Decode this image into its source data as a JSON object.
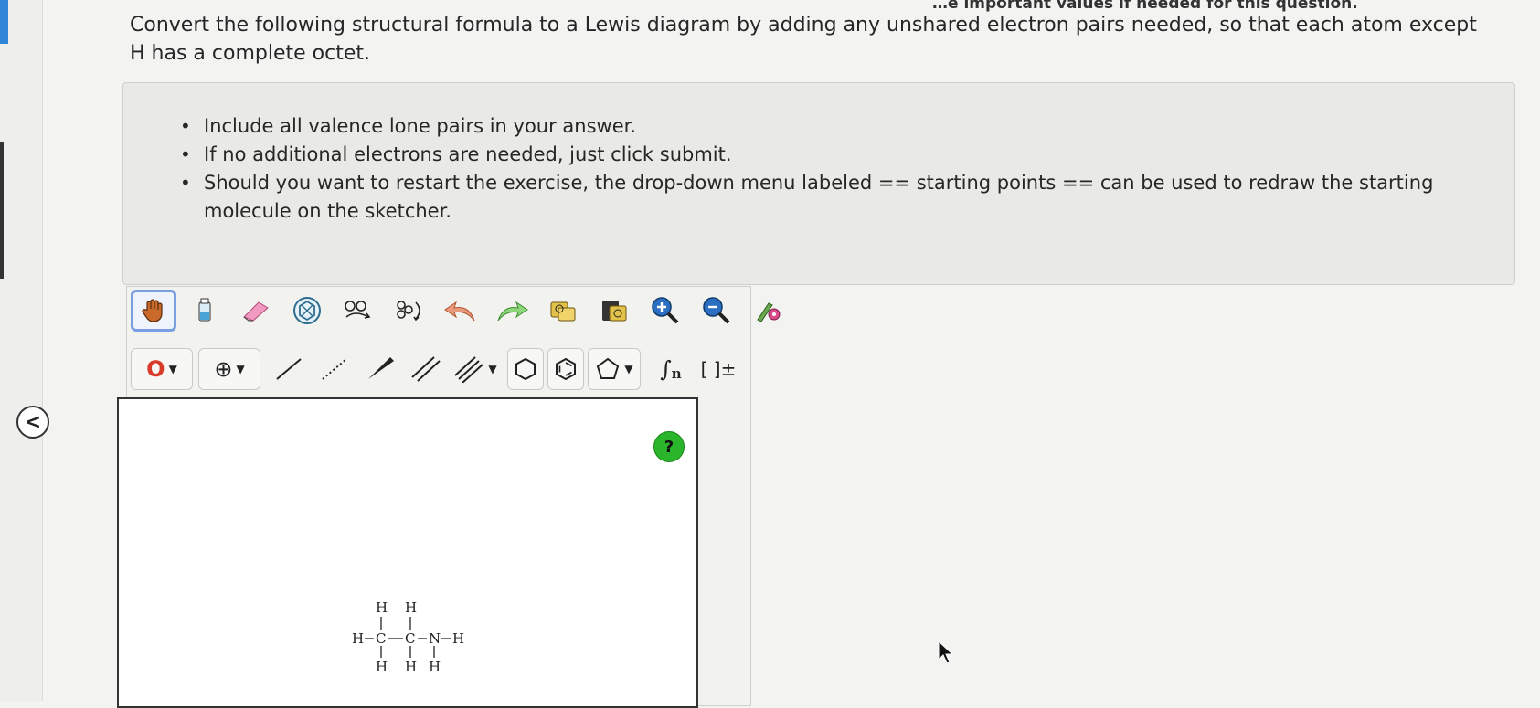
{
  "header_fragment": "…e important values if needed for this question.",
  "question": "Convert the following structural formula to a Lewis diagram by adding any unshared electron pairs needed, so that each atom except H has a complete octet.",
  "instructions": [
    "Include all valence lone pairs in your answer.",
    "If no additional electrons are needed, just click submit.",
    "Should you want to restart the exercise, the drop-down menu labeled == starting points == can be used to redraw the starting molecule on the sketcher."
  ],
  "toolbar": {
    "row1_icons": [
      "hand-move-icon",
      "clear-flask-icon",
      "eraser-icon",
      "template-ring-icon",
      "sprout-clean-icon",
      "rotate-structure-icon",
      "undo-icon",
      "redo-icon",
      "copy-icon",
      "paste-icon",
      "zoom-in-icon",
      "zoom-out-icon",
      "settings-tools-icon"
    ],
    "element_label": "O",
    "charge_label": "⊕",
    "bracket_label": "[ ]±",
    "sgroup_label": "n"
  },
  "accent_colors": {
    "selected_tool_border": "#7a9fe0",
    "help_icon": "#2bb52b",
    "element_red": "#d93b2b",
    "left_blue": "#2f86d6"
  },
  "help_label": "?",
  "molecule": {
    "atoms": {
      "h_top_1": "H",
      "h_top_2": "H",
      "h_left": "H",
      "c1": "C",
      "c2": "C",
      "n": "N",
      "h_right": "H",
      "h_bot_1": "H",
      "h_bot_2": "H",
      "h_bot_3": "H"
    }
  },
  "collapse_label": "<"
}
